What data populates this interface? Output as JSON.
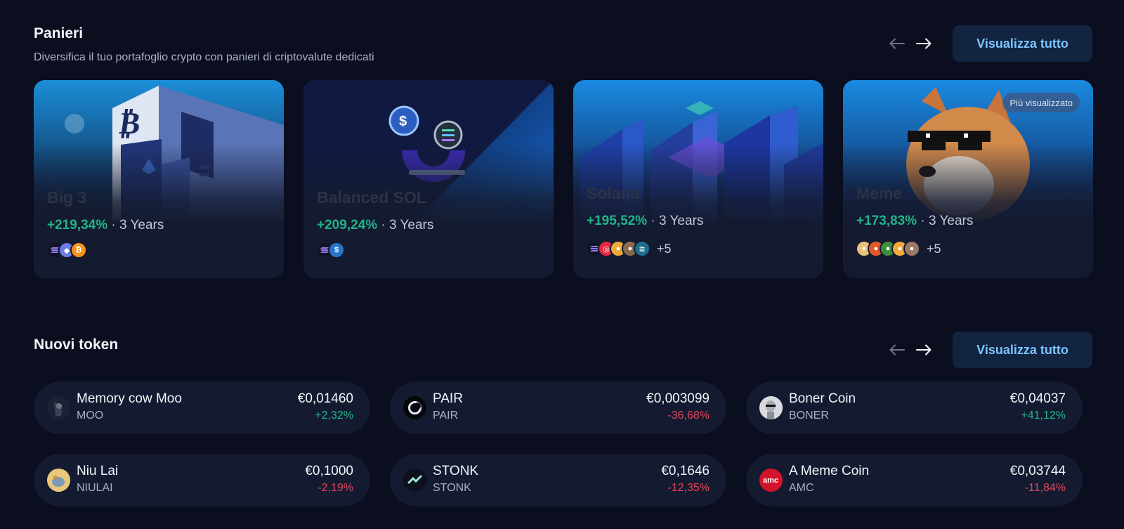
{
  "baskets_section": {
    "title": "Panieri",
    "subtitle": "Diversifica il tuo portafoglio crypto con panieri di criptovalute dedicati",
    "view_all": "Visualizza tutto",
    "cards": [
      {
        "name": "Big 3",
        "change": "+219,34%",
        "period": "· 3 Years",
        "coins": [
          "solana-icon",
          "ethereum-icon",
          "bitcoin-icon"
        ],
        "more": ""
      },
      {
        "name": "Balanced SOL",
        "change": "+209,24%",
        "period": "· 3 Years",
        "coins": [
          "solana-icon",
          "usdc-icon"
        ],
        "more": ""
      },
      {
        "name": "Solana",
        "change": "+195,52%",
        "period": "· 3 Years",
        "coins": [
          "solana-icon",
          "token-red-icon",
          "bonk-icon",
          "dog-icon",
          "wave-icon"
        ],
        "more": "+5"
      },
      {
        "name": "Meme",
        "change": "+173,83%",
        "period": "· 3 Years",
        "coins": [
          "doge-icon",
          "shiba-icon",
          "pepe-icon",
          "bonk-icon",
          "wif-icon"
        ],
        "more": "+5",
        "badge": "Più visualizzato"
      }
    ]
  },
  "tokens_section": {
    "title": "Nuovi token",
    "view_all": "Visualizza tutto",
    "tokens": [
      {
        "name": "Memory cow Moo",
        "symbol": "MOO",
        "price": "€0,01460",
        "change": "+2,32%",
        "positive": true
      },
      {
        "name": "PAIR",
        "symbol": "PAIR",
        "price": "€0,003099",
        "change": "-36,68%",
        "positive": false
      },
      {
        "name": "Boner Coin",
        "symbol": "BONER",
        "price": "€0,04037",
        "change": "+41,12%",
        "positive": true
      },
      {
        "name": "Niu Lai",
        "symbol": "NIULAI",
        "price": "€0,1000",
        "change": "-2,19%",
        "positive": false
      },
      {
        "name": "STONK",
        "symbol": "STONK",
        "price": "€0,1646",
        "change": "-12,35%",
        "positive": false
      },
      {
        "name": "A Meme Coin",
        "symbol": "AMC",
        "price": "€0,03744",
        "change": "-11,84%",
        "positive": false
      }
    ]
  },
  "colors": {
    "background": "#0a0e1f",
    "card": "#141b30",
    "accent": "#7cc4ff",
    "positive": "#22b489",
    "negative": "#e0465d"
  }
}
